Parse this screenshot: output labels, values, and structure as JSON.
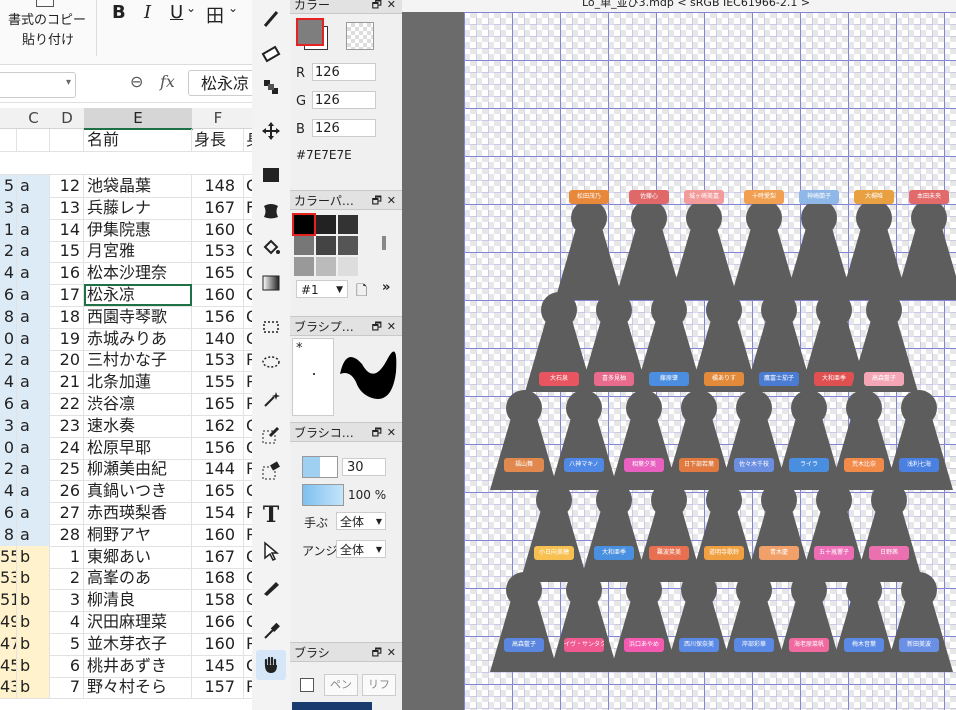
{
  "ribbon": {
    "format_copy_label": "書式のコピー",
    "paste_label": "貼り付け",
    "bold": "B",
    "italic": "I",
    "underline": "U",
    "underline_caret": "⌄",
    "border": "田",
    "border_caret": "⌄"
  },
  "formula_bar": {
    "fx": "fx",
    "value": "松永凉"
  },
  "sheet": {
    "columns": [
      "C",
      "D",
      "E",
      "F"
    ],
    "header_row": {
      "name": "名前",
      "height": "身長"
    },
    "rows": [
      {
        "a": "5",
        "c": "a",
        "d": "12",
        "e": "池袋晶葉",
        "f": "148",
        "g": "C"
      },
      {
        "a": "3",
        "c": "a",
        "d": "13",
        "e": "兵藤レナ",
        "f": "167",
        "g": "F"
      },
      {
        "a": "1",
        "c": "a",
        "d": "14",
        "e": "伊集院惠",
        "f": "160",
        "g": "C"
      },
      {
        "a": "2",
        "c": "a",
        "d": "15",
        "e": "月宮雅",
        "f": "153",
        "g": "C"
      },
      {
        "a": "4",
        "c": "a",
        "d": "16",
        "e": "松本沙理奈",
        "f": "165",
        "g": "C"
      },
      {
        "a": "6",
        "c": "a",
        "d": "17",
        "e": "松永凉",
        "f": "160",
        "g": "C"
      },
      {
        "a": "8",
        "c": "a",
        "d": "18",
        "e": "西園寺琴歌",
        "f": "156",
        "g": "C"
      },
      {
        "a": "0",
        "c": "a",
        "d": "19",
        "e": "赤城みりあ",
        "f": "140",
        "g": "C"
      },
      {
        "a": "2",
        "c": "a",
        "d": "20",
        "e": "三村かな子",
        "f": "153",
        "g": "P"
      },
      {
        "a": "4",
        "c": "a",
        "d": "21",
        "e": "北条加蓮",
        "f": "155",
        "g": "P"
      },
      {
        "a": "6",
        "c": "a",
        "d": "22",
        "e": "渋谷凛",
        "f": "165",
        "g": "P"
      },
      {
        "a": "3",
        "c": "a",
        "d": "23",
        "e": "速水奏",
        "f": "162",
        "g": "C"
      },
      {
        "a": "0",
        "c": "a",
        "d": "24",
        "e": "松原早耶",
        "f": "156",
        "g": "C"
      },
      {
        "a": "2",
        "c": "a",
        "d": "25",
        "e": "柳瀬美由紀",
        "f": "144",
        "g": "P"
      },
      {
        "a": "4",
        "c": "a",
        "d": "26",
        "e": "真鍋いつき",
        "f": "165",
        "g": "C"
      },
      {
        "a": "6",
        "c": "a",
        "d": "27",
        "e": "赤西瑛梨香",
        "f": "154",
        "g": "P"
      },
      {
        "a": "8",
        "c": "a",
        "d": "28",
        "e": "桐野アヤ",
        "f": "160",
        "g": "P"
      },
      {
        "a": "55",
        "c": "b",
        "d": "1",
        "e": "東郷あい",
        "f": "167",
        "g": "C"
      },
      {
        "a": "53",
        "c": "b",
        "d": "2",
        "e": "高峯のあ",
        "f": "168",
        "g": "C"
      },
      {
        "a": "51",
        "c": "b",
        "d": "3",
        "e": "柳清良",
        "f": "158",
        "g": "C"
      },
      {
        "a": "49",
        "c": "b",
        "d": "4",
        "e": "沢田麻理菜",
        "f": "166",
        "g": "C"
      },
      {
        "a": "47",
        "c": "b",
        "d": "5",
        "e": "並木芽衣子",
        "f": "160",
        "g": "P"
      },
      {
        "a": "45",
        "c": "b",
        "d": "6",
        "e": "桃井あずき",
        "f": "145",
        "g": "C"
      },
      {
        "a": "43",
        "c": "b",
        "d": "7",
        "e": "野々村そら",
        "f": "157",
        "g": "P"
      }
    ]
  },
  "titlebar": "Lo_単_並び3.mdp < sRGB IEC61966-2.1 >",
  "panels": {
    "color": {
      "title": "カラー",
      "r_label": "R",
      "g_label": "G",
      "b_label": "B",
      "r": "126",
      "g": "126",
      "b": "126",
      "hex": "#7E7E7E",
      "fg_color": "#7e7e7e"
    },
    "palette": {
      "title": "カラーパ…",
      "selected": "#1",
      "swatches": [
        "#000000",
        "#222222",
        "#333333",
        "#777777",
        "#444444",
        "#555555",
        "#999999",
        "#bbbbbb",
        "#dddddd"
      ]
    },
    "brush_preview": {
      "title": "ブラシプ…",
      "star": "*"
    },
    "brush_control": {
      "title": "ブラシコ…",
      "size": "30",
      "opacity": "100 %",
      "hand_label": "手ぶ",
      "hand_value": "全体",
      "aa_label": "アンジ",
      "aa_value": "全体"
    },
    "brush": {
      "title": "ブラシ",
      "pen": "ペン",
      "ri": "リフ"
    }
  },
  "canvas_tags": [
    "松田茂乃",
    "佐藤心",
    "城ヶ崎美嘉",
    "十時愛梨",
    "神崎蘭子",
    "大槻唯",
    "本田未央",
    "大石泉",
    "喜多見柚",
    "藤原肇",
    "橘ありす",
    "鷹富士茄子",
    "大和亜季",
    "高森藍子",
    "福山舞",
    "八神マキノ",
    "相葉夕美",
    "日下部若葉",
    "佐々木千枝",
    "ライラ",
    "荒木比奈",
    "浅利七海",
    "小日向美穂",
    "大和亜季",
    "難波笑美",
    "道明寺歌鈴",
    "青木慶",
    "五十嵐響子",
    "日野茜",
    "高森藍子",
    "イヴ・サンタクロース",
    "浜口あやめ",
    "西川保奈美",
    "岸部彩華",
    "海老原菜帆",
    "梅木音葉",
    "新田美波"
  ]
}
